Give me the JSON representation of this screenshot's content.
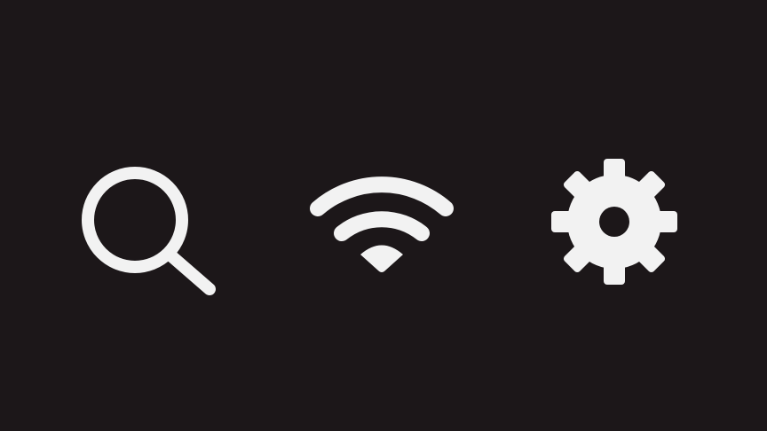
{
  "theme": {
    "background": "#1c1719",
    "icon_color": "#f2f2f2"
  },
  "icons": [
    {
      "name": "search-icon"
    },
    {
      "name": "wifi-icon"
    },
    {
      "name": "gear-icon"
    }
  ]
}
